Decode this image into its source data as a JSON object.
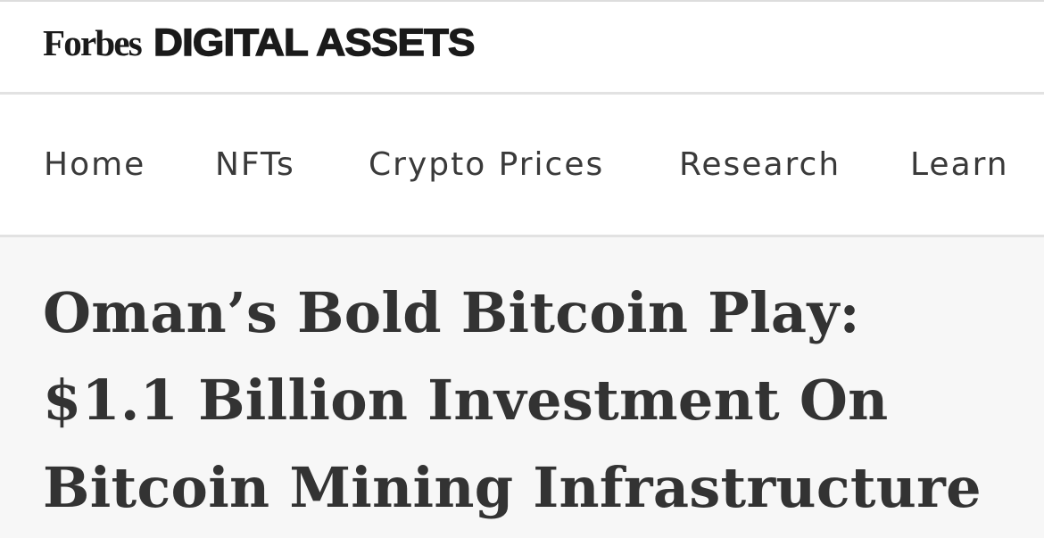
{
  "header": {
    "brand_primary": "Forbes",
    "brand_section": "DIGITAL ASSETS"
  },
  "nav": {
    "items": [
      {
        "label": "Home"
      },
      {
        "label": "NFTs"
      },
      {
        "label": "Crypto Prices"
      },
      {
        "label": "Research"
      },
      {
        "label": "Learn"
      }
    ]
  },
  "article": {
    "headline": "Oman’s Bold Bitcoin Play: $1.1 Billion Investment On Bitcoin Mining Infrastructure"
  },
  "colors": {
    "text": "#333333",
    "nav_text": "#3a3a3a",
    "header_bg": "#ffffff",
    "article_bg": "#f7f7f7",
    "divider": "#e2e2e2"
  }
}
